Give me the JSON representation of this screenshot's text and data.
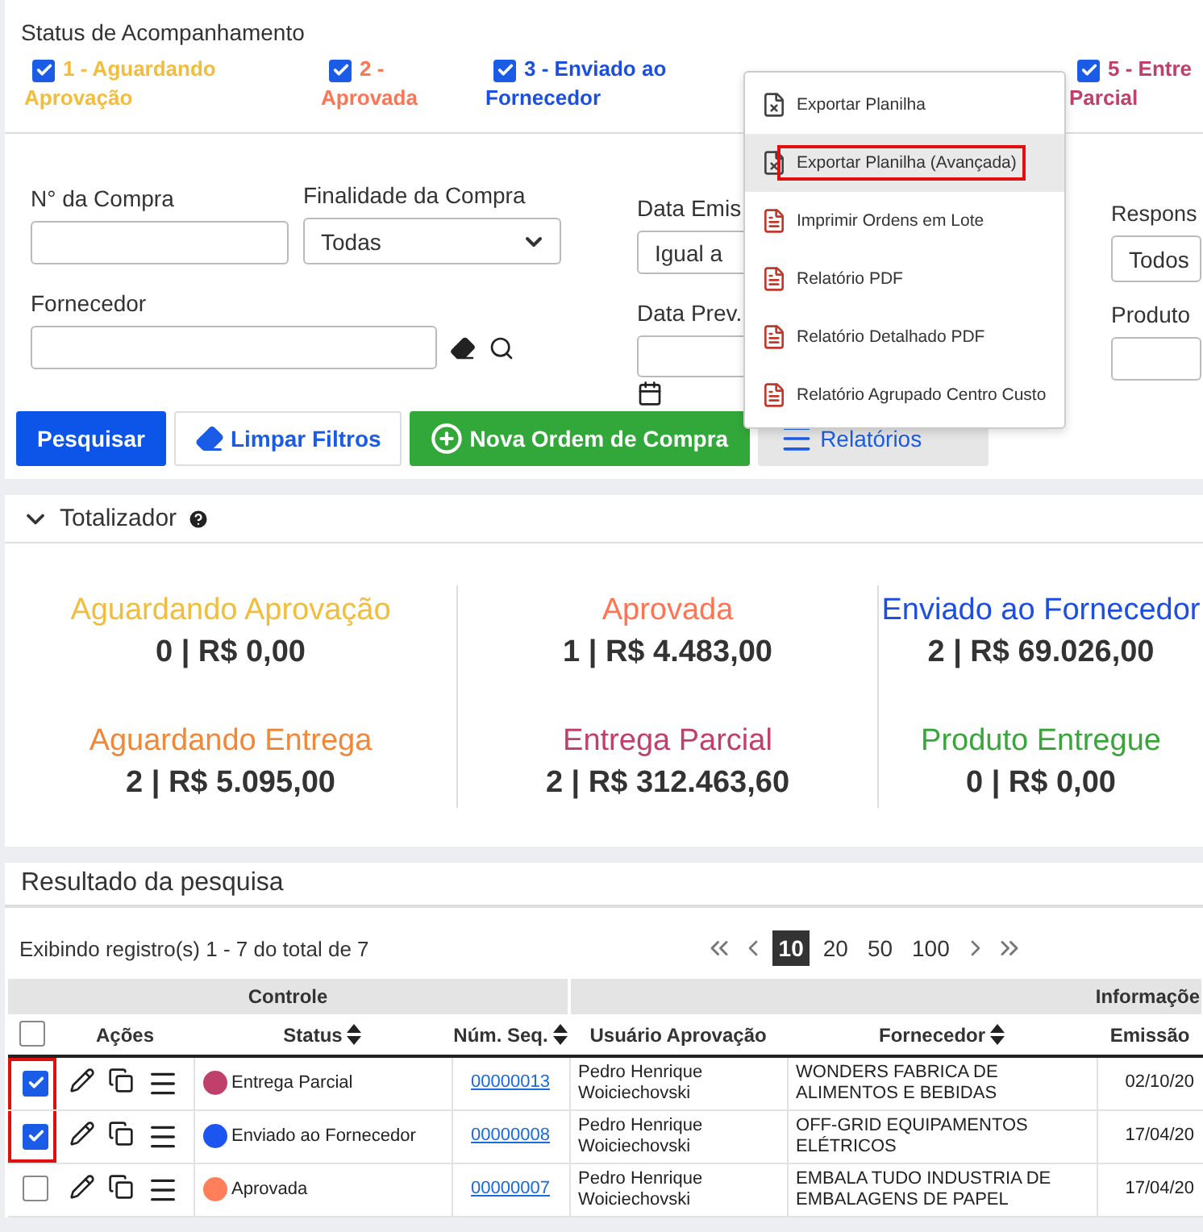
{
  "status_filter": {
    "title": "Status de Acompanhamento",
    "options": [
      {
        "label": "1 - Aguardando Aprovação",
        "checked": true,
        "color": "#f2bd3c"
      },
      {
        "label": "2 - Aprovada",
        "checked": true,
        "color": "#ff7452"
      },
      {
        "label": "3 - Enviado ao Fornecedor",
        "checked": true,
        "color": "#1c4fe0"
      },
      {
        "label": "5 - Entre Parcial",
        "checked": true,
        "color": "#c0406c"
      }
    ]
  },
  "filters": {
    "purchase_number": {
      "label": "N° da Compra"
    },
    "purpose": {
      "label": "Finalidade da Compra",
      "value": "Todas"
    },
    "supplier": {
      "label": "Fornecedor"
    },
    "emission_date": {
      "label": "Data Emis",
      "value": "Igual a"
    },
    "expected_delivery": {
      "label": "Data Prev."
    },
    "responsible": {
      "label": "Respons",
      "value": "Todos"
    },
    "product": {
      "label": "Produto"
    }
  },
  "buttons": [
    {
      "label": "Pesquisar",
      "kind": "primary"
    },
    {
      "label": "Limpar Filtros",
      "kind": "outline"
    },
    {
      "label": "Nova Ordem de Compra",
      "kind": "success"
    },
    {
      "label": "Relatórios",
      "kind": "menu"
    }
  ],
  "reports_menu": [
    {
      "label": "Exportar Planilha",
      "kind": "excel",
      "highlighted": false
    },
    {
      "label": "Exportar Planilha (Avançada)",
      "kind": "excel",
      "highlighted": true
    },
    {
      "label": "Imprimir Ordens em Lote",
      "kind": "pdf",
      "highlighted": false
    },
    {
      "label": "Relatório PDF",
      "kind": "pdf",
      "highlighted": false
    },
    {
      "label": "Relatório Detalhado PDF",
      "kind": "pdf",
      "highlighted": false
    },
    {
      "label": "Relatório Agrupado Centro Custo",
      "kind": "pdf",
      "highlighted": false
    }
  ],
  "totals": {
    "title": "Totalizador",
    "expanded": true,
    "cards": [
      {
        "label": "Aguardando Aprovação",
        "value": "0 | R$ 0,00",
        "color": "#f2bd3c"
      },
      {
        "label": "Aprovada",
        "value": "1 | R$ 4.483,00",
        "color": "#ff7452"
      },
      {
        "label": "Enviado ao Fornecedor",
        "value": "2 | R$ 69.026,00",
        "color": "#1c4fe0"
      },
      {
        "label": "Aguardando Entrega",
        "value": "2 | R$ 5.095,00",
        "color": "#f0883a"
      },
      {
        "label": "Entrega Parcial",
        "value": "2 | R$ 312.463,60",
        "color": "#c0406c"
      },
      {
        "label": "Produto Entregue",
        "value": "0 | R$ 0,00",
        "color": "#3aa53a"
      }
    ]
  },
  "results": {
    "title": "Resultado da pesquisa",
    "summary": "Exibindo registro(s) 1 - 7 do total de 7",
    "page_sizes": [
      {
        "label": "10",
        "selected": true
      },
      {
        "label": "20",
        "selected": false
      },
      {
        "label": "50",
        "selected": false
      },
      {
        "label": "100",
        "selected": false
      }
    ],
    "groups": [
      "Controle",
      "Informaçõe"
    ],
    "select_all": {
      "checked": false
    },
    "columns": [
      {
        "label": "Ações",
        "sortable": false
      },
      {
        "label": "Status",
        "sortable": true
      },
      {
        "label": "Núm. Seq.",
        "sortable": true
      },
      {
        "label": "Usuário Aprovação",
        "sortable": false
      },
      {
        "label": "Fornecedor",
        "sortable": true
      },
      {
        "label": "Emissão",
        "sortable": false
      }
    ],
    "rows": [
      {
        "checked": true,
        "highlighted": true,
        "status": "Entrega Parcial",
        "color": "#c0406c",
        "seq": "00000013",
        "user": "Pedro Henrique Woiciechovski",
        "supplier": "WONDERS FABRICA DE ALIMENTOS E BEBIDAS",
        "emission": "02/10/20"
      },
      {
        "checked": true,
        "highlighted": true,
        "status": "Enviado ao Fornecedor",
        "color": "#1c55f0",
        "seq": "00000008",
        "user": "Pedro Henrique Woiciechovski",
        "supplier": "OFF-GRID EQUIPAMENTOS ELÉTRICOS",
        "emission": "17/04/20"
      },
      {
        "checked": false,
        "highlighted": false,
        "status": "Aprovada",
        "color": "#ff7f5a",
        "seq": "00000007",
        "user": "Pedro Henrique Woiciechovski",
        "supplier": "EMBALA TUDO INDUSTRIA DE EMBALAGENS DE PAPEL",
        "emission": "17/04/20"
      }
    ]
  }
}
